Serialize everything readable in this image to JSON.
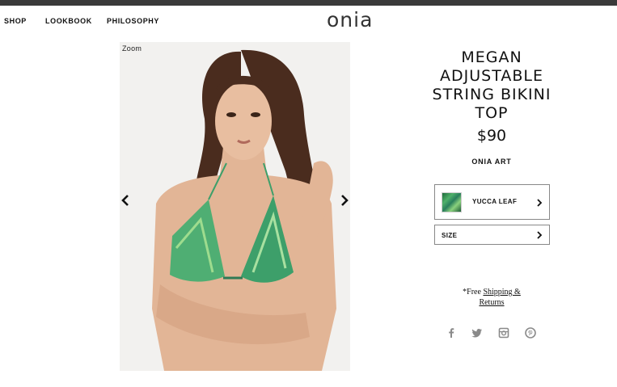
{
  "nav": {
    "shop": "SHOP",
    "lookbook": "LOOKBOOK",
    "philosophy": "PHILOSOPHY"
  },
  "logo": "onia",
  "gallery": {
    "zoom_label": "Zoom",
    "prev_icon": "chevron-left-icon",
    "next_icon": "chevron-right-icon"
  },
  "product": {
    "title_lines": [
      "MEGAN",
      "ADJUSTABLE",
      "STRING BIKINI",
      "TOP"
    ],
    "price": "$90",
    "collection": "ONIA ART"
  },
  "options": {
    "color_label": "YUCCA LEAF",
    "size_label": "SIZE"
  },
  "shipping": {
    "prefix": "*Free ",
    "link_line1": "Shipping &",
    "link_line2": "Returns"
  },
  "social": [
    "facebook-icon",
    "twitter-icon",
    "instagram-icon",
    "pinterest-icon"
  ],
  "colors": {
    "top_bar": "#3a3a3a",
    "text": "#111111",
    "icon_grey": "#8a8a8a",
    "photo_bg": "#f2f1ef"
  }
}
